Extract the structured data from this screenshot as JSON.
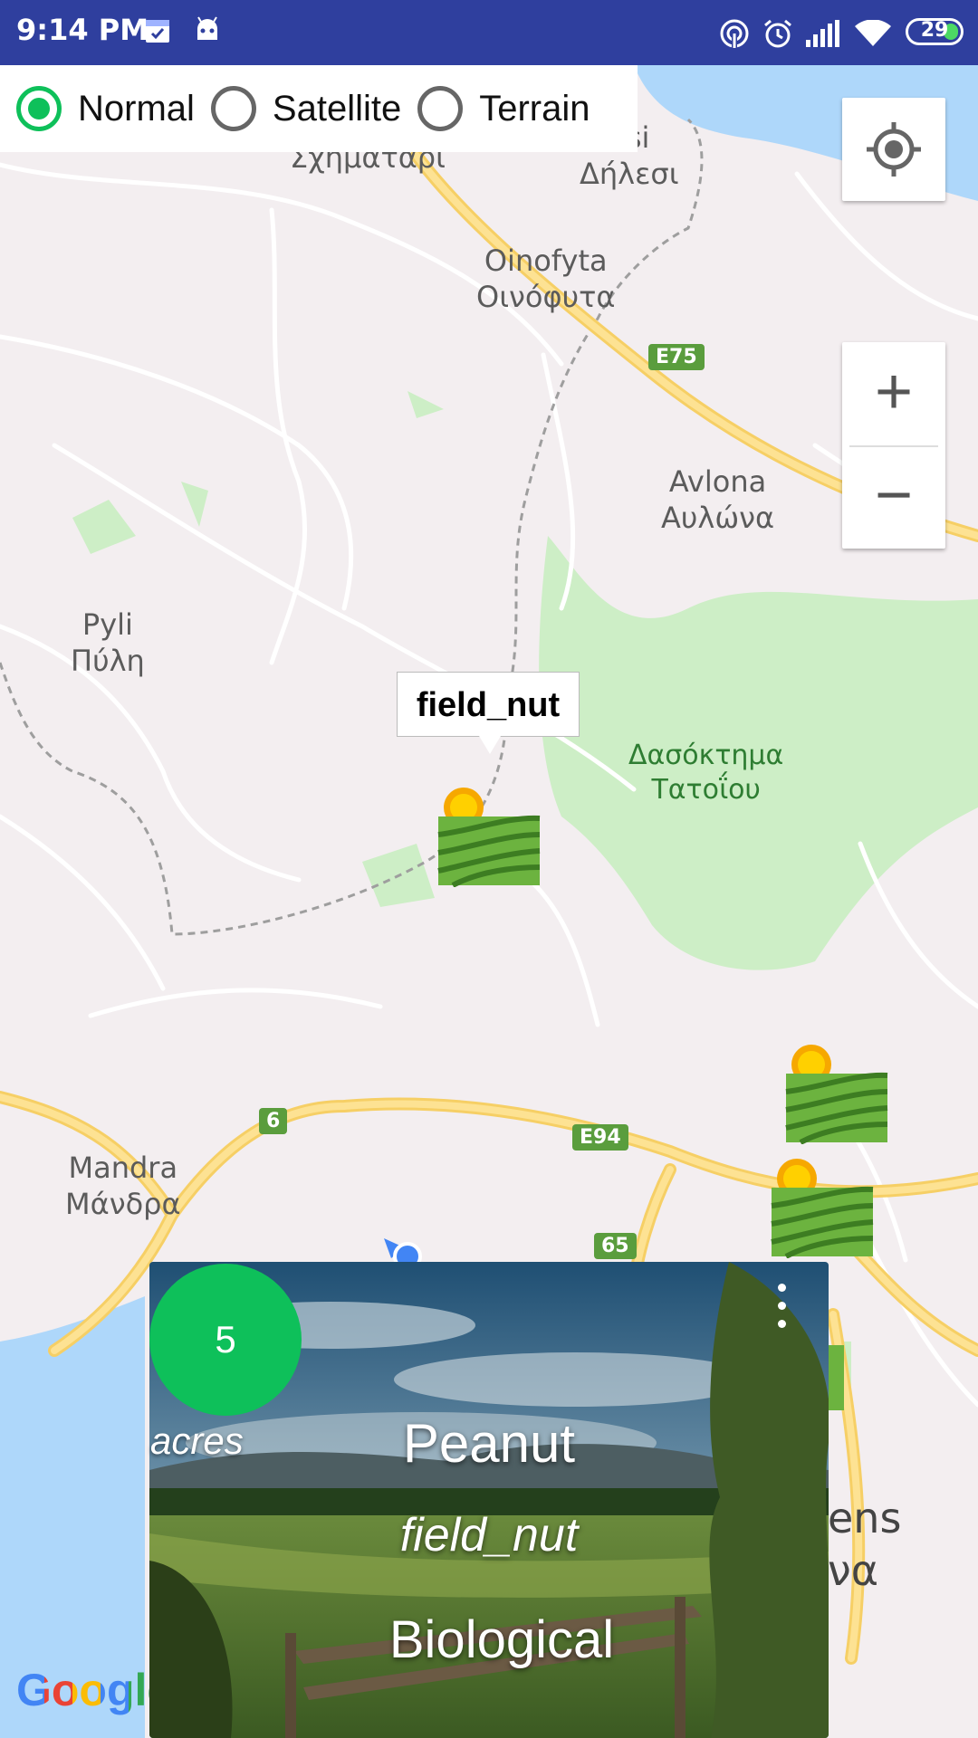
{
  "status_bar": {
    "time": "9:14 PM",
    "battery": "29",
    "battery_level": 0.29
  },
  "map_type": {
    "selected": "Normal",
    "options": [
      {
        "label": "Normal"
      },
      {
        "label": "Satellite"
      },
      {
        "label": "Terrain"
      }
    ]
  },
  "map": {
    "places": [
      {
        "text": "Σχηματάρι"
      },
      {
        "text": "esi\nΔήλεσι"
      },
      {
        "text": "Oinofyta\nΟινόφυτα"
      },
      {
        "text": "Avlona\nΑυλώνα"
      },
      {
        "text": "Pyli\nΠύλη"
      },
      {
        "text": "Δασόκτημα\nΤατοΐου"
      },
      {
        "text": "Mandra\nΜάνδρα"
      },
      {
        "text": "ens\nνα"
      }
    ],
    "roads": [
      {
        "label": "E75"
      },
      {
        "label": "6"
      },
      {
        "label": "E94"
      },
      {
        "label": "65"
      }
    ],
    "logo": "Google",
    "marker_title": "field_nut"
  },
  "controls": {
    "zoom_in": "+",
    "zoom_out": "−"
  },
  "card": {
    "badge": "5",
    "unit": "acres",
    "crop": "Peanut",
    "field": "field_nut",
    "type": "Biological"
  },
  "colors": {
    "accent": "#0ec05a",
    "status_bar": "#2f3f9e",
    "road": "#fde293"
  }
}
